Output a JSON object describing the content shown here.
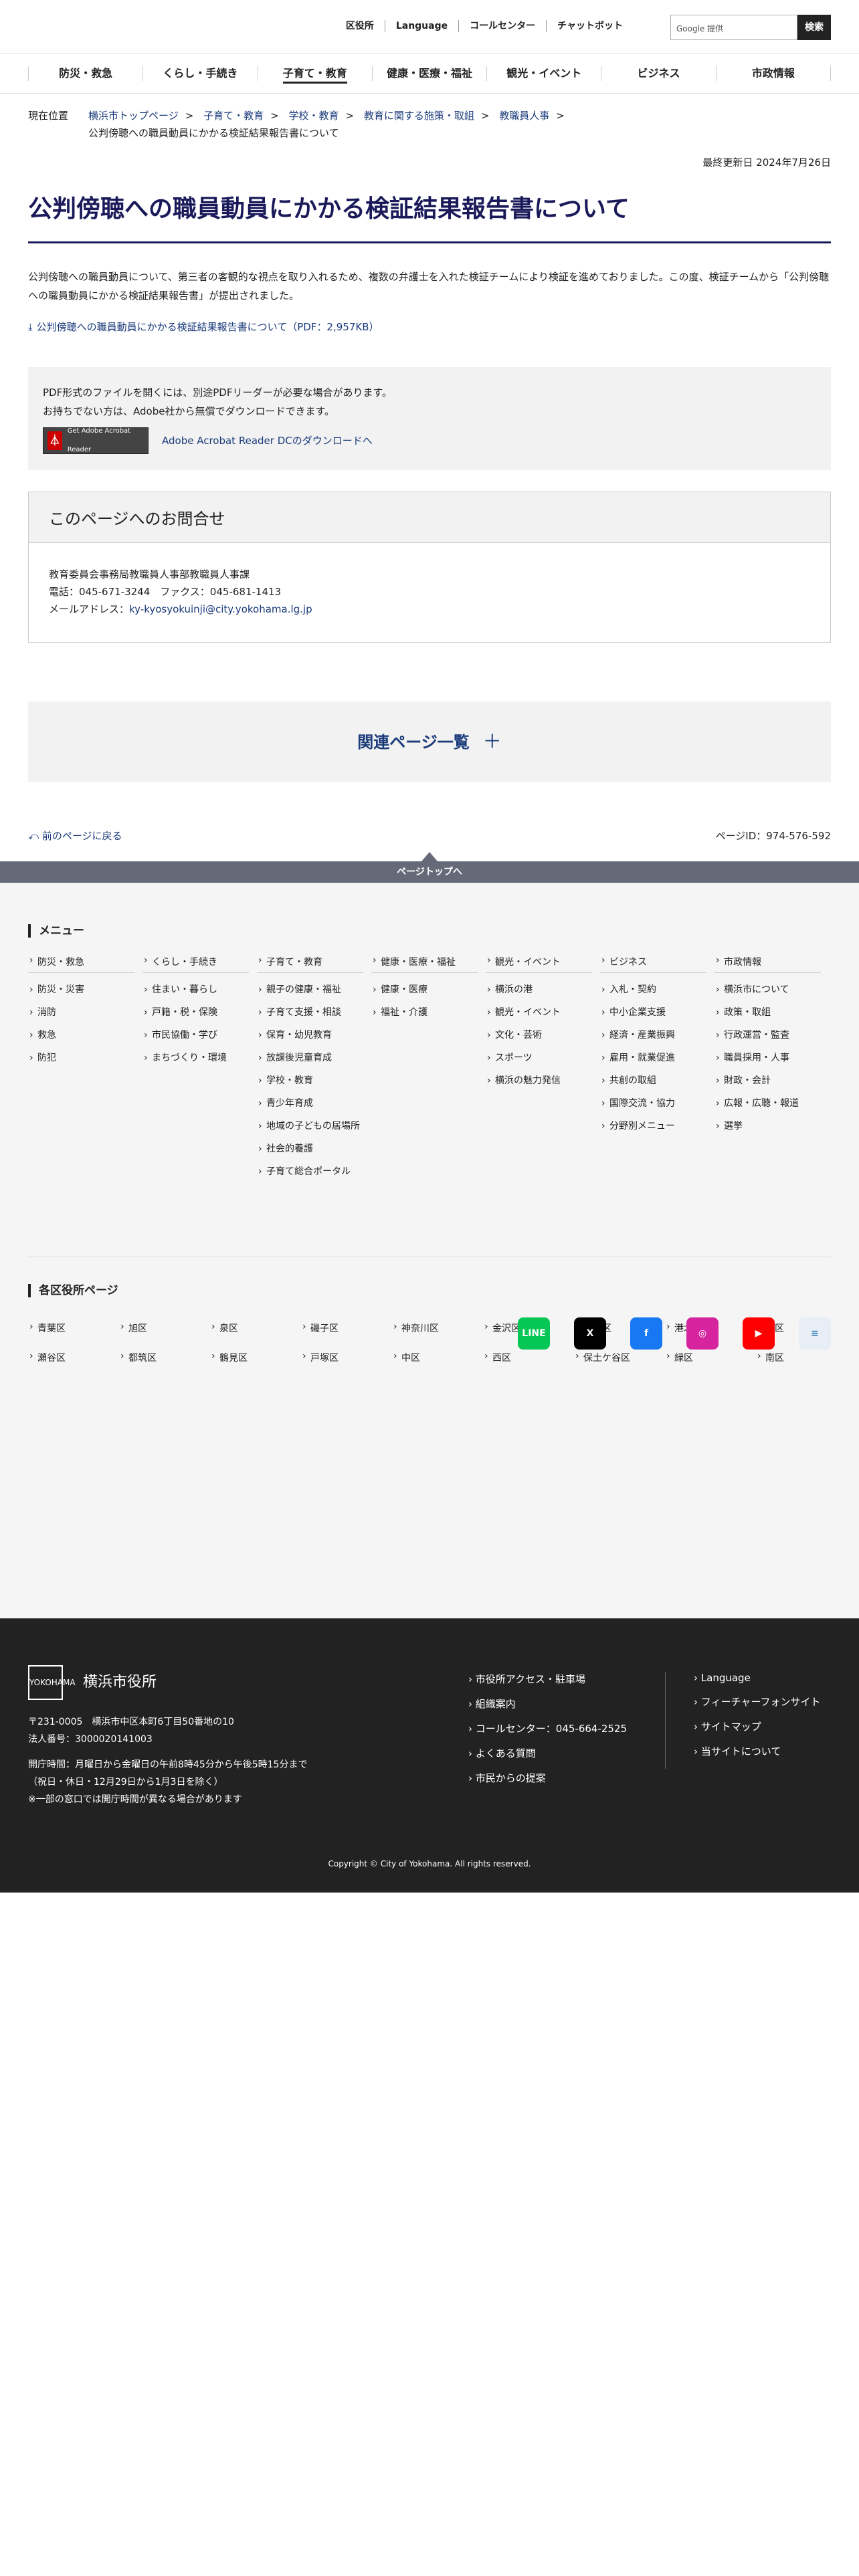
{
  "util": {
    "links": [
      "区役所",
      "Language",
      "コールセンター",
      "チャットボット"
    ],
    "search_placeholder": "Google 提供",
    "search_button": "検索"
  },
  "gnav": [
    "防災・救急",
    "くらし・手続き",
    "子育て・教育",
    "健康・医療・福祉",
    "観光・イベント",
    "ビジネス",
    "市政情報"
  ],
  "breadcrumb": {
    "label": "現在位置",
    "items": [
      "横浜市トップページ",
      "子育て・教育",
      "学校・教育",
      "教育に関する施策・取組",
      "教職員人事"
    ],
    "current": "公判傍聴への職員動員にかかる検証結果報告書について"
  },
  "updated": "最終更新日 2024年7月26日",
  "title": "公判傍聴への職員動員にかかる検証結果報告書について",
  "lead": "公判傍聴への職員動員について、第三者の客観的な視点を取り入れるため、複数の弁護士を入れた検証チームにより検証を進めておりました。この度、検証チームから「公判傍聴への職員動員にかかる検証結果報告書」が提出されました。",
  "download": "公判傍聴への職員動員にかかる検証結果報告書について（PDF：2,957KB）",
  "pdf": {
    "line1": "PDF形式のファイルを開くには、別途PDFリーダーが必要な場合があります。",
    "line2": "お持ちでない方は、Adobe社から無償でダウンロードできます。",
    "badge": "Get Adobe Acrobat Reader",
    "link": "Adobe Acrobat Reader DCのダウンロードへ"
  },
  "contact": {
    "heading": "このページへのお問合せ",
    "dept": "教育委員会事務局教職員人事部教職員人事課",
    "phone": "電話：045-671-3244　ファクス：045-681-1413",
    "mail_label": "メールアドレス：",
    "mail": "ky-kyosyokuinji@city.yokohama.lg.jp"
  },
  "related": "関連ページ一覧",
  "back": "前のページに戻る",
  "page_id": "ページID：974-576-592",
  "pagetop": "ページトップへ",
  "menu": {
    "title": "メニュー",
    "cols": [
      {
        "head": "防災・救急",
        "items": [
          "防災・災害",
          "消防",
          "救急",
          "防犯"
        ]
      },
      {
        "head": "くらし・手続き",
        "items": [
          "住まい・暮らし",
          "戸籍・税・保険",
          "市民協働・学び",
          "まちづくり・環境"
        ]
      },
      {
        "head": "子育て・教育",
        "items": [
          "親子の健康・福祉",
          "子育て支援・相談",
          "保育・幼児教育",
          "放課後児童育成",
          "学校・教育",
          "青少年育成",
          "地域の子どもの居場所",
          "社会的養護",
          "子育て総合ポータル"
        ]
      },
      {
        "head": "健康・医療・福祉",
        "items": [
          "健康・医療",
          "福祉・介護"
        ]
      },
      {
        "head": "観光・イベント",
        "items": [
          "横浜の港",
          "観光・イベント",
          "文化・芸術",
          "スポーツ",
          "横浜の魅力発信"
        ]
      },
      {
        "head": "ビジネス",
        "items": [
          "入札・契約",
          "中小企業支援",
          "経済・産業振興",
          "雇用・就業促進",
          "共創の取組",
          "国際交流・協力",
          "分野別メニュー"
        ]
      },
      {
        "head": "市政情報",
        "items": [
          "横浜市について",
          "政策・取組",
          "行政運営・監査",
          "職員採用・人事",
          "財政・会計",
          "広報・広聴・報道",
          "選挙"
        ]
      }
    ]
  },
  "wards": {
    "title": "各区役所ページ",
    "items": [
      "青葉区",
      "旭区",
      "泉区",
      "磯子区",
      "神奈川区",
      "金沢区",
      "港南区",
      "港北区",
      "栄区",
      "瀬谷区",
      "都筑区",
      "鶴見区",
      "戸塚区",
      "中区",
      "西区",
      "保土ケ谷区",
      "緑区",
      "南区"
    ]
  },
  "sns": [
    {
      "name": "line-icon",
      "label": "LINE",
      "color": "#06c755"
    },
    {
      "name": "x-icon",
      "label": "X",
      "color": "#000000"
    },
    {
      "name": "facebook-icon",
      "label": "f",
      "color": "#1877f2"
    },
    {
      "name": "instagram-icon",
      "label": "◎",
      "color": "#d6249f"
    },
    {
      "name": "youtube-icon",
      "label": "▶",
      "color": "#ff0000"
    },
    {
      "name": "news-icon",
      "label": "≡",
      "color": "#e8eef5"
    }
  ],
  "footer": {
    "org": "横浜市役所",
    "mark": "YOKOHAMA",
    "address": "〒231-0005　横浜市中区本町6丁目50番地の10",
    "corp": "法人番号：3000020141003",
    "hours1": "開庁時間：月曜日から金曜日の午前8時45分から午後5時15分まで",
    "hours2": "（祝日・休日・12月29日から1月3日を除く）",
    "hours3": "※一部の窓口では開庁時間が異なる場合があります",
    "links1": [
      "市役所アクセス・駐車場",
      "組織案内",
      "コールセンター：045-664-2525",
      "よくある質問",
      "市民からの提案"
    ],
    "links2": [
      "Language",
      "フィーチャーフォンサイト",
      "サイトマップ",
      "当サイトについて"
    ],
    "copyright": "Copyright © City of Yokohama. All rights reserved."
  }
}
